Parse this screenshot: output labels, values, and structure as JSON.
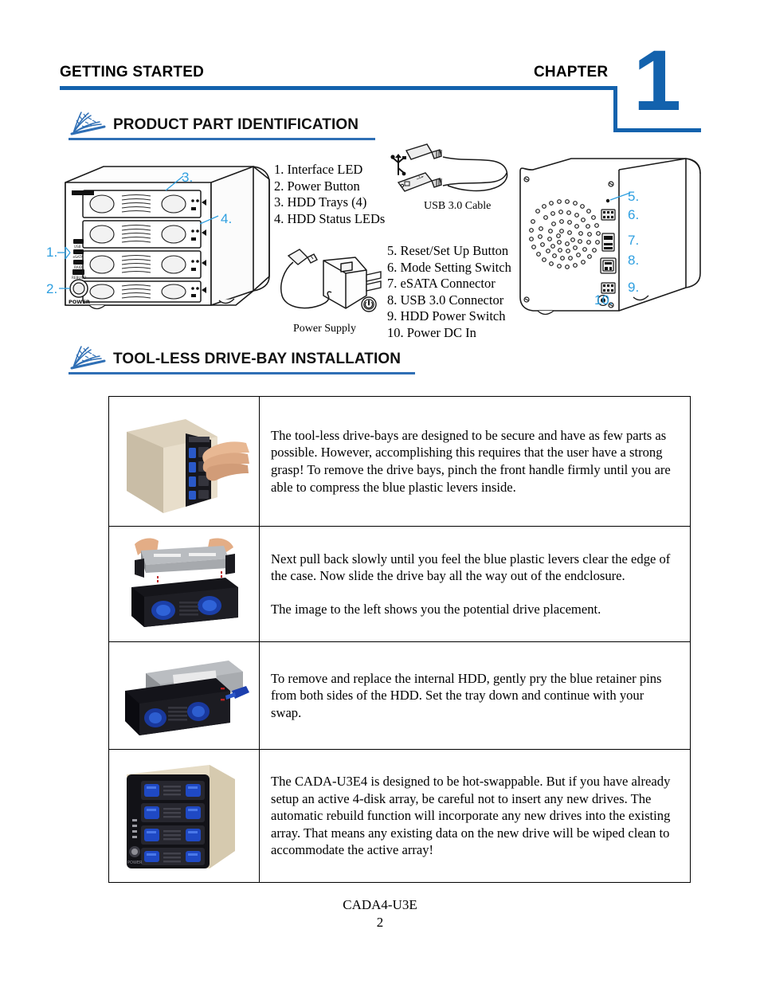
{
  "header": {
    "left_title": "GETTING STARTED",
    "right_title": "CHAPTER",
    "chapter_number": "1",
    "accent_color": "#1362ad"
  },
  "sections": [
    {
      "title": "PRODUCT PART IDENTIFICATION",
      "icon": "wheat-sheaf-icon"
    },
    {
      "title": "TOOL-LESS DRIVE-BAY INSTALLATION",
      "icon": "wheat-sheaf-icon"
    }
  ],
  "part_identification": {
    "front_list": [
      "1. Interface LED",
      "2. Power Button",
      "3. HDD Trays (4)",
      "4. HDD Status LEDs"
    ],
    "rear_list": [
      "5. Reset/Set Up Button",
      "6. Mode Setting Switch",
      "7. eSATA Connector",
      "8. USB 3.0 Connector",
      "9. HDD Power Switch",
      "10.  Power DC In"
    ],
    "accessory_captions": {
      "usb_cable": "USB 3.0 Cable",
      "power_supply": "Power Supply"
    },
    "front_callouts": [
      "1.",
      "2.",
      "3.",
      "4."
    ],
    "rear_callouts": [
      "5.",
      "6.",
      "7.",
      "8.",
      "9.",
      "10."
    ],
    "front_panel_label": "POWER",
    "front_led_labels": [
      "USB",
      "eSATA",
      "RAID",
      "REBUILD"
    ],
    "callout_color": "#2e9fe0"
  },
  "installation_steps": [
    {
      "image_name": "photo-pinch-front-handle",
      "paragraphs": [
        "The tool-less drive-bays are designed to be secure and have as few parts as possible. However, accomplishing this requires that the user have a strong grasp! To remove the drive bays, pinch the front handle firmly until you are able to compress the blue plastic levers inside."
      ]
    },
    {
      "image_name": "photo-drive-tray-placement",
      "paragraphs": [
        "Next pull back slowly until you feel the blue plastic levers clear the edge of the case. Now slide the drive bay all the way out of the endclosure.",
        "The image to the left shows you the potential drive placement."
      ]
    },
    {
      "image_name": "photo-hdd-retainer-pins",
      "paragraphs": [
        "To remove and replace the internal HDD, gently pry the blue retainer pins from both sides of the HDD. Set the tray down and continue with your swap."
      ]
    },
    {
      "image_name": "photo-enclosure-front",
      "paragraphs": [
        "The CADA-U3E4 is designed to be hot-swappable. But if you have already setup an active 4-disk array, be careful not to insert any new drives. The automatic rebuild function will incorporate any new drives into the existing array. That means any existing data on the new drive will be wiped clean to accommodate the active array!"
      ]
    }
  ],
  "footer": {
    "model": "CADA4-U3E",
    "page_number": "2"
  }
}
